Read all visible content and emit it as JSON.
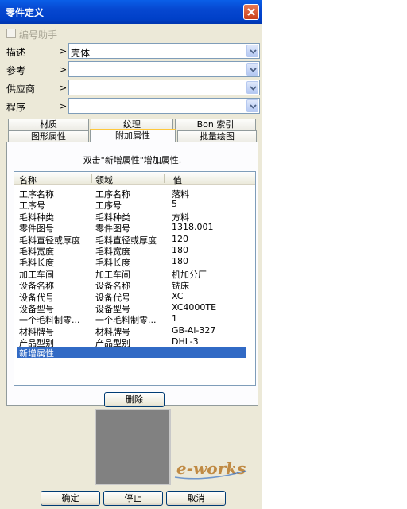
{
  "window": {
    "title": "零件定义"
  },
  "numbering_helper": {
    "label": "编号助手",
    "checked": false
  },
  "fields": [
    {
      "label": "描述",
      "arrow": ">",
      "value": "壳体"
    },
    {
      "label": "参考",
      "arrow": ">",
      "value": ""
    },
    {
      "label": "供应商",
      "arrow": ">",
      "value": ""
    },
    {
      "label": "程序",
      "arrow": ">",
      "value": ""
    }
  ],
  "tabs_row1": [
    {
      "label": "材质"
    },
    {
      "label": "纹理"
    },
    {
      "label": "Bon 索引"
    }
  ],
  "tabs_row2": [
    {
      "label": "图形属性"
    },
    {
      "label": "附加属性",
      "active": true
    },
    {
      "label": "批量绘图"
    }
  ],
  "hint": "双击\"新增属性\"增加属性.",
  "table": {
    "columns": [
      "名称",
      "领域",
      "值"
    ],
    "rows": [
      [
        "工序名称",
        "工序名称",
        "落料"
      ],
      [
        "工序号",
        "工序号",
        "5"
      ],
      [
        "毛料种类",
        "毛料种类",
        "方料"
      ],
      [
        "零件图号",
        "零件图号",
        "1318.001"
      ],
      [
        "毛料直径或厚度",
        "毛料直径或厚度",
        "120"
      ],
      [
        "毛料宽度",
        "毛料宽度",
        "180"
      ],
      [
        "毛料长度",
        "毛料长度",
        "180"
      ],
      [
        "加工车间",
        "加工车间",
        "机加分厂"
      ],
      [
        "设备名称",
        "设备名称",
        "铣床"
      ],
      [
        "设备代号",
        "设备代号",
        "XC"
      ],
      [
        "设备型号",
        "设备型号",
        "XC4000TE"
      ],
      [
        "一个毛料制零...",
        "一个毛料制零...",
        "1"
      ],
      [
        "材料牌号",
        "材料牌号",
        "GB-Al-327"
      ],
      [
        "产品型别",
        "产品型别",
        "DHL-3"
      ]
    ],
    "new_row": "新增属性"
  },
  "buttons": {
    "delete": "删除",
    "ok": "确定",
    "stop": "停止",
    "cancel": "取消"
  },
  "watermark": "e-works",
  "colors": {
    "titlebar": "#0a5fe8",
    "selection": "#316ac5",
    "preview": "#818181"
  }
}
